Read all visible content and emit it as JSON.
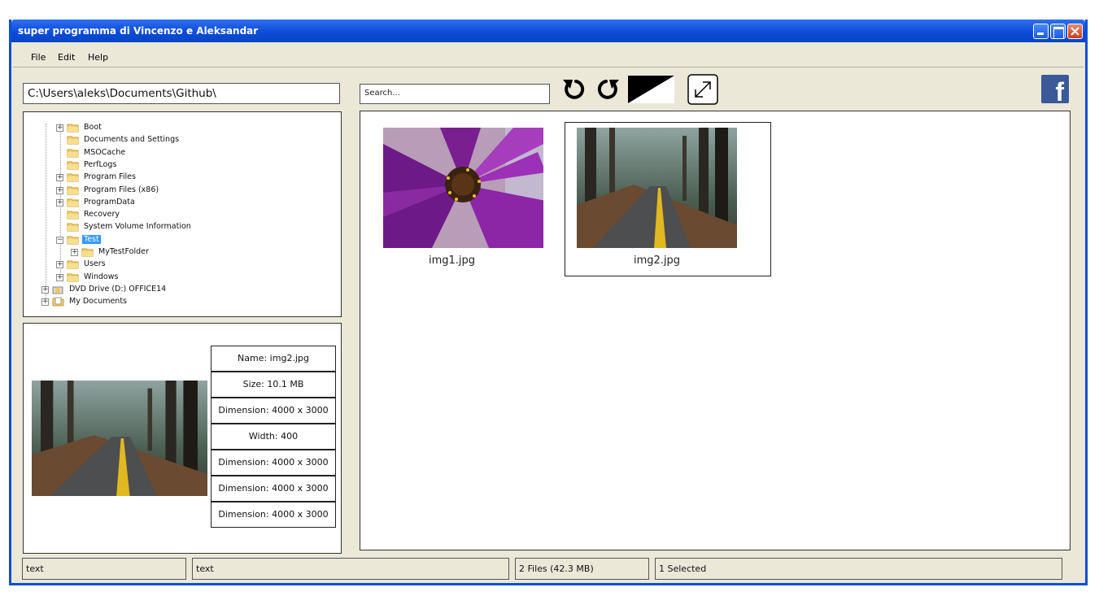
{
  "window": {
    "title": "super programma di Vincenzo e Aleksandar"
  },
  "menu": [
    "File",
    "Edit",
    "Help"
  ],
  "toolbar": {
    "path_value": "C:\\Users\\aleks\\Documents\\Github\\",
    "search_placeholder": "Search...",
    "fb_glyph": "f"
  },
  "tree": [
    {
      "label": "Boot",
      "expander": "+"
    },
    {
      "label": "Documents and Settings",
      "expander": ""
    },
    {
      "label": "MSOCache",
      "expander": ""
    },
    {
      "label": "PerfLogs",
      "expander": ""
    },
    {
      "label": "Program Files",
      "expander": "+"
    },
    {
      "label": "Program Files (x86)",
      "expander": "+"
    },
    {
      "label": "ProgramData",
      "expander": "+"
    },
    {
      "label": "Recovery",
      "expander": ""
    },
    {
      "label": "System Volume Information",
      "expander": ""
    },
    {
      "label": "Test",
      "expander": "−",
      "selected": true
    },
    {
      "label": "MyTestFolder",
      "expander": "+"
    },
    {
      "label": "Users",
      "expander": "+"
    },
    {
      "label": "Windows",
      "expander": "+"
    },
    {
      "label": "DVD Drive (D:) OFFICE14",
      "expander": "+"
    },
    {
      "label": "My Documents",
      "expander": "+"
    }
  ],
  "info": [
    "Name: img2.jpg",
    "Size: 10.1 MB",
    "Dimension: 4000 x 3000",
    "Width: 400",
    "Dimension: 4000 x 3000",
    "Dimension: 4000 x 3000",
    "Dimension: 4000 x 3000"
  ],
  "gallery": [
    {
      "name": "img1.jpg",
      "selected": false
    },
    {
      "name": "img2.jpg",
      "selected": true
    }
  ],
  "status": [
    "text",
    "text",
    "2 Files (42.3 MB)",
    "1 Selected"
  ],
  "colors": {
    "titlebar": "#0a4ad8",
    "window_bg": "#ebe8d8",
    "selection": "#3399ff",
    "facebook": "#3b5998"
  }
}
